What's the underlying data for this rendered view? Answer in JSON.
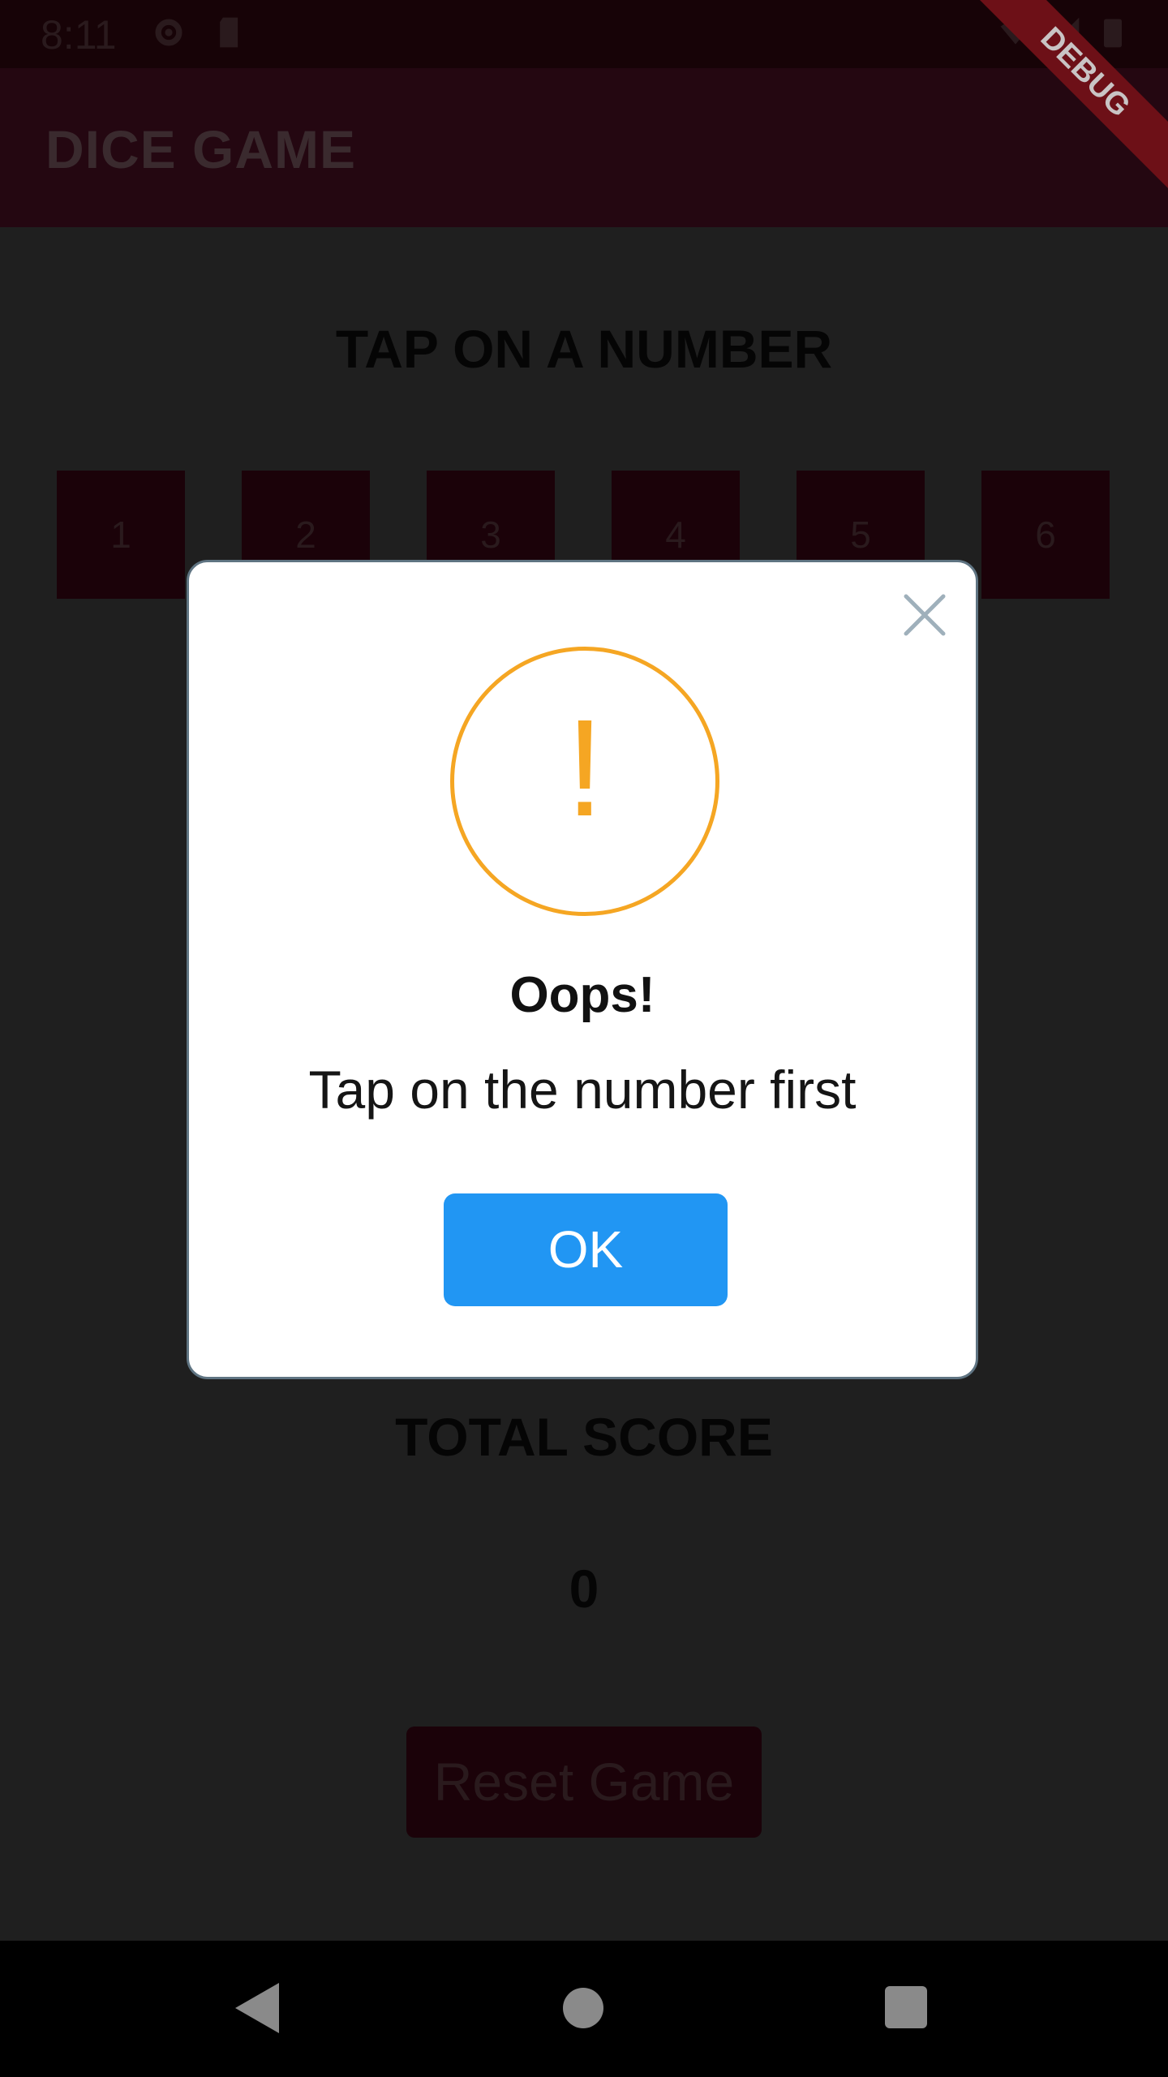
{
  "status_bar": {
    "time": "8:11"
  },
  "app_bar": {
    "title": "DICE GAME",
    "debug_label": "DEBUG"
  },
  "main": {
    "instruction": "TAP ON A NUMBER",
    "number_buttons": [
      "1",
      "2",
      "3",
      "4",
      "5",
      "6"
    ],
    "total_score_label": "TOTAL SCORE",
    "total_score_value": "0",
    "reset_label": "Reset Game"
  },
  "dialog": {
    "icon": "exclamation-icon",
    "icon_glyph": "!",
    "title": "Oops!",
    "message": "Tap on the number first",
    "ok_label": "OK",
    "accent_color": "#f5a623",
    "ok_color": "#2196f3"
  },
  "colors": {
    "app_bar": "#240711",
    "number_button": "#1b0209",
    "debug_banner": "#6d1017"
  }
}
